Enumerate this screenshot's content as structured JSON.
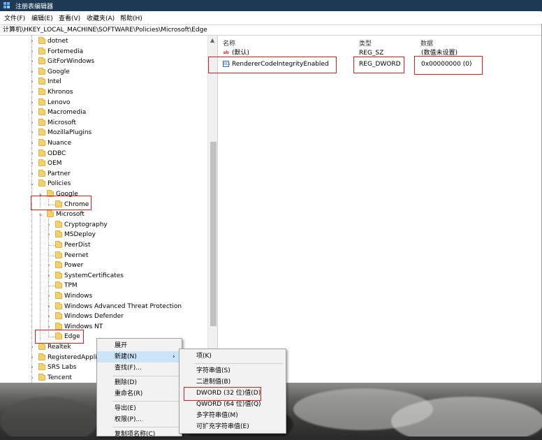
{
  "window": {
    "title": "注册表编辑器",
    "menus": [
      "文件(F)",
      "编辑(E)",
      "查看(V)",
      "收藏夹(A)",
      "帮助(H)"
    ],
    "address": "计算机\\HKEY_LOCAL_MACHINE\\SOFTWARE\\Policies\\Microsoft\\Edge"
  },
  "tree": {
    "software_children": [
      "dotnet",
      "Fortemedia",
      "GitForWindows",
      "Google",
      "Intel",
      "Khronos",
      "Lenovo",
      "Macromedia",
      "Microsoft",
      "MozillaPlugins",
      "Nuance",
      "ODBC",
      "OEM",
      "Partner",
      "Policies"
    ],
    "policies": {
      "google": "Google",
      "chrome": "Chrome",
      "microsoft": "Microsoft",
      "microsoft_children": [
        "Cryptography",
        "MSDeploy",
        "PeerDist",
        "Peernet",
        "Power",
        "SystemCertificates",
        "TPM",
        "Windows",
        "Windows Advanced Threat Protection",
        "Windows Defender",
        "Windows NT",
        "Edge"
      ]
    },
    "after_policies": [
      "Realtek",
      "RegisteredApplic",
      "SRS Labs",
      "Tencent"
    ]
  },
  "values": {
    "headers": {
      "name": "名称",
      "type": "类型",
      "data": "数据"
    },
    "rows": [
      {
        "name": "(默认)",
        "type": "REG_SZ",
        "data": "(数值未设置)",
        "icon": "ab"
      },
      {
        "name": "RendererCodeIntegrityEnabled",
        "type": "REG_DWORD",
        "data": "0x00000000 (0)",
        "icon": "dword"
      }
    ]
  },
  "context_menu": {
    "items": [
      "展开",
      "新建(N)",
      "查找(F)...",
      "删除(D)",
      "重命名(R)",
      "导出(E)",
      "权限(P)...",
      "复制项名称(C)"
    ]
  },
  "submenu": {
    "items": [
      "项(K)",
      "字符串值(S)",
      "二进制值(B)",
      "DWORD (32 位)值(D)",
      "QWORD (64 位)值(Q)",
      "多字符串值(M)",
      "可扩充字符串值(E)"
    ]
  },
  "colors": {
    "highlight": "#cce4f7",
    "annotation": "#e01c1c",
    "titlebar": "#1f3a55"
  }
}
